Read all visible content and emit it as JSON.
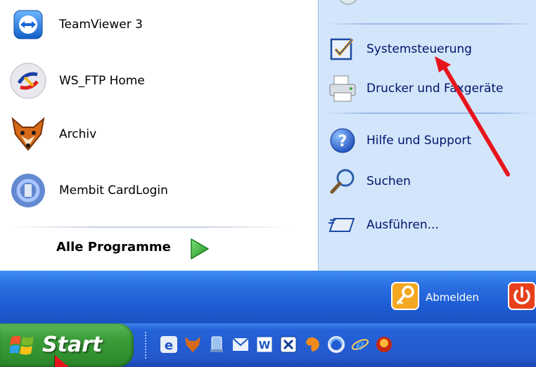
{
  "left_pane": {
    "items": [
      {
        "label": "TeamViewer 3",
        "icon": "teamviewer-icon"
      },
      {
        "label": "WS_FTP Home",
        "icon": "ws-ftp-icon"
      },
      {
        "label": "Archiv",
        "icon": "fox-icon"
      },
      {
        "label": "Membit CardLogin",
        "icon": "membit-icon"
      }
    ],
    "all_programs": {
      "label": "Alle Programme",
      "icon": "green-arrow-icon"
    }
  },
  "right_pane": {
    "items": [
      {
        "label": "Systemsteuerung",
        "icon": "control-panel-icon"
      },
      {
        "label": "Drucker und Faxgeräte",
        "icon": "printer-icon"
      },
      {
        "label": "Hilfe und Support",
        "icon": "help-icon"
      },
      {
        "label": "Suchen",
        "icon": "search-icon"
      },
      {
        "label": "Ausführen...",
        "icon": "run-icon"
      }
    ]
  },
  "footer": {
    "logoff_label": "Abmelden",
    "shutdown_icon": "power-icon"
  },
  "taskbar": {
    "start_label": "Start",
    "quick_launch": [
      "ie-e-icon",
      "fox-icon",
      "desktop-icon",
      "outlook-icon",
      "word-icon",
      "app-icon",
      "firefox-icon",
      "sync-icon",
      "ie-icon",
      "media-icon"
    ]
  },
  "colors": {
    "right_pane_bg": "#d3e5fa",
    "footer_blue": "#2a6ee0",
    "start_green": "#3b9e3a",
    "annotation_red": "#e8141c"
  }
}
